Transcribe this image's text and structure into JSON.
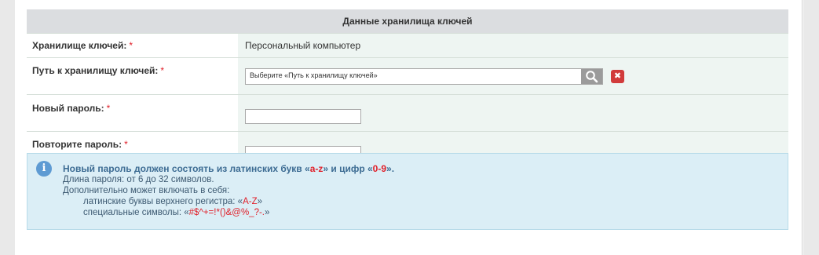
{
  "section_title": "Данные хранилища ключей",
  "required_mark": "*",
  "rows": {
    "storage": {
      "label": "Хранилище ключей:",
      "value": "Персональный компьютер"
    },
    "path": {
      "label": "Путь к хранилищу ключей:",
      "placeholder": "Выберите «Путь к хранилищу ключей»",
      "clear_symbol": "✖"
    },
    "new_password": {
      "label": "Новый пароль:",
      "value": ""
    },
    "repeat_password": {
      "label": "Повторите пароль:",
      "value": ""
    }
  },
  "notice": {
    "head_prefix": "Новый пароль должен состоять из латинских букв «",
    "letters": "a-z",
    "head_middle": "» и цифр «",
    "digits": "0-9",
    "head_suffix": "».",
    "line_length": "Длина пароля: от 6 до 32 символов.",
    "line_extra": "Дополнительно может включать в себя:",
    "upper_prefix": "латинские буквы верхнего регистра: «",
    "upper_value": "A-Z",
    "upper_suffix": "»",
    "special_prefix": "специальные символы: «",
    "special_value": "#$^+=!*()&@%_?-.",
    "special_suffix": "»",
    "icon_glyph": "i"
  },
  "colors": {
    "header_bg": "#dbdde0",
    "value_bg": "#eef5f2",
    "required": "#e0202a",
    "notice_bg": "#dbeef6",
    "info_icon": "#5e9bd3",
    "clear_button": "#d13b3b"
  },
  "icons": {
    "search": "search-icon",
    "clear": "close-icon",
    "info": "info-icon"
  }
}
